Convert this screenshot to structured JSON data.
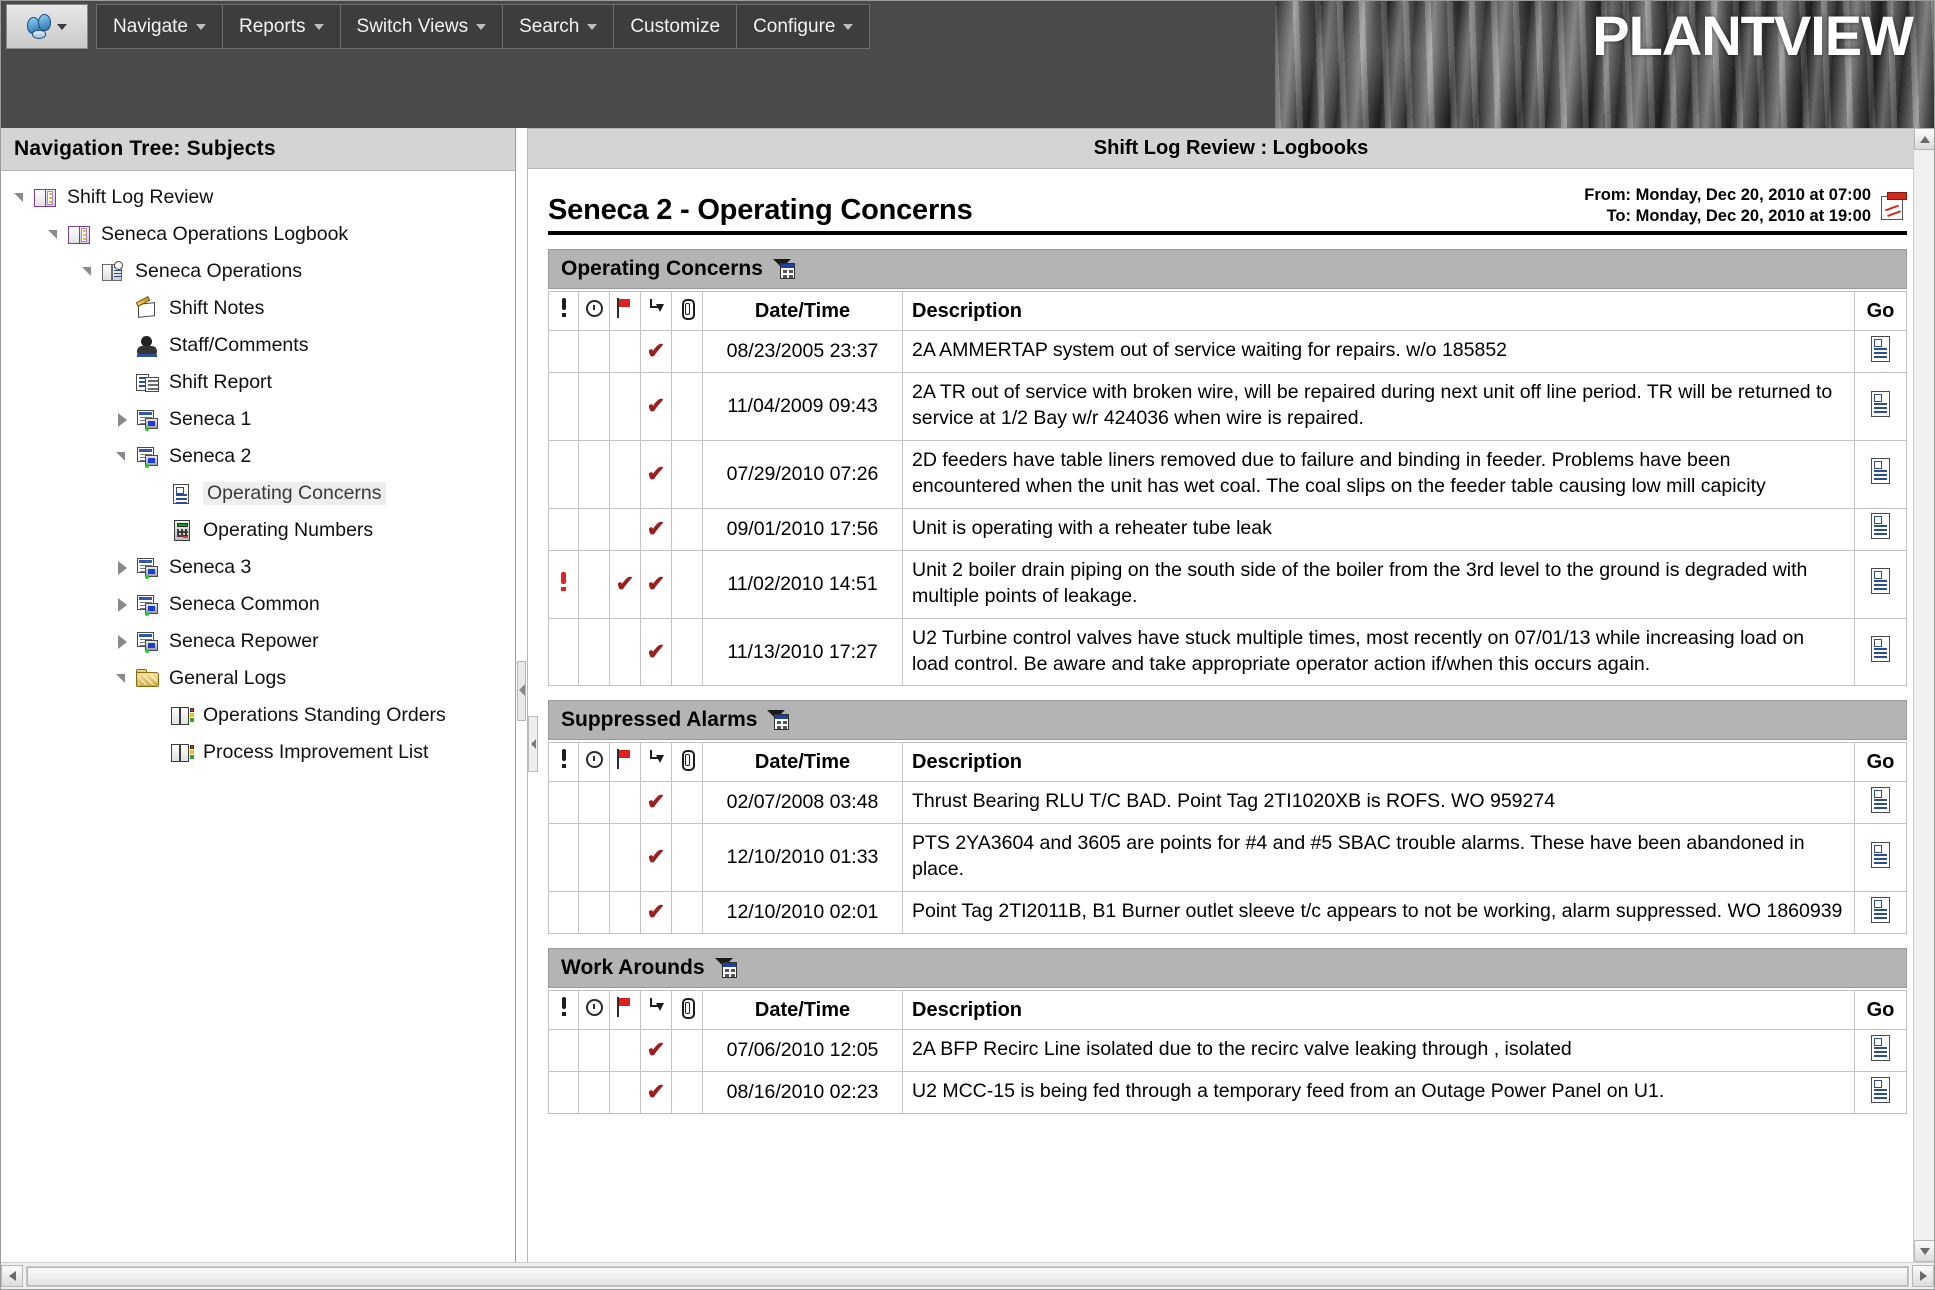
{
  "app": {
    "brand": "PLANTVIEW"
  },
  "menubar": {
    "logo_icon": "people-logo-icon",
    "items": [
      {
        "label": "Navigate",
        "has_caret": true
      },
      {
        "label": "Reports",
        "has_caret": true
      },
      {
        "label": "Switch Views",
        "has_caret": true
      },
      {
        "label": "Search",
        "has_caret": true
      },
      {
        "label": "Customize",
        "has_caret": false
      },
      {
        "label": "Configure",
        "has_caret": true
      }
    ]
  },
  "nav": {
    "header": "Navigation Tree: Subjects",
    "items": [
      {
        "label": "Shift Log Review",
        "indent": 0,
        "twisty": "open",
        "icon": "book-icon",
        "selected": false
      },
      {
        "label": "Seneca Operations Logbook",
        "indent": 1,
        "twisty": "open",
        "icon": "book-icon",
        "selected": false
      },
      {
        "label": "Seneca Operations",
        "indent": 2,
        "twisty": "open",
        "icon": "book-clock-icon",
        "selected": false
      },
      {
        "label": "Shift Notes",
        "indent": 3,
        "twisty": "none",
        "icon": "notes-icon",
        "selected": false
      },
      {
        "label": "Staff/Comments",
        "indent": 3,
        "twisty": "none",
        "icon": "staff-icon",
        "selected": false
      },
      {
        "label": "Shift Report",
        "indent": 3,
        "twisty": "none",
        "icon": "report-icon",
        "selected": false
      },
      {
        "label": "Seneca 1",
        "indent": 3,
        "twisty": "closed",
        "icon": "unit-icon",
        "selected": false
      },
      {
        "label": "Seneca 2",
        "indent": 3,
        "twisty": "open",
        "icon": "unit-icon",
        "selected": false
      },
      {
        "label": "Operating Concerns",
        "indent": 4,
        "twisty": "none",
        "icon": "document-icon",
        "selected": true
      },
      {
        "label": "Operating Numbers",
        "indent": 4,
        "twisty": "none",
        "icon": "calculator-icon",
        "selected": false
      },
      {
        "label": "Seneca 3",
        "indent": 3,
        "twisty": "closed",
        "icon": "unit-icon",
        "selected": false
      },
      {
        "label": "Seneca Common",
        "indent": 3,
        "twisty": "closed",
        "icon": "unit-icon",
        "selected": false
      },
      {
        "label": "Seneca Repower",
        "indent": 3,
        "twisty": "closed",
        "icon": "unit-icon",
        "selected": false
      },
      {
        "label": "General Logs",
        "indent": 3,
        "twisty": "open",
        "icon": "folder-icon",
        "selected": false
      },
      {
        "label": "Operations Standing Orders",
        "indent": 4,
        "twisty": "none",
        "icon": "color-book-icon",
        "selected": false
      },
      {
        "label": "Process Improvement List",
        "indent": 4,
        "twisty": "none",
        "icon": "color-book-icon",
        "selected": false
      }
    ]
  },
  "content": {
    "header": "Shift Log Review : Logbooks",
    "page_title": "Seneca 2 - Operating Concerns",
    "date_from": "From: Monday, Dec 20, 2010 at 07:00",
    "date_to": "To: Monday, Dec 20, 2010 at 19:00",
    "export_icon": "pdf-export-icon",
    "columns": {
      "priority_icon": "exclamation-icon",
      "time_icon": "clock-icon",
      "flag_icon": "red-flag-icon",
      "followup_icon": "hook-arrow-icon",
      "attachment_icon": "paperclip-icon",
      "datetime": "Date/Time",
      "description": "Description",
      "go": "Go"
    },
    "sections": [
      {
        "title": "Operating Concerns",
        "filter_icon": "filter-grid-icon",
        "rows": [
          {
            "priority": false,
            "time": false,
            "flag": false,
            "followup": true,
            "attachment": false,
            "datetime": "08/23/2005 23:37",
            "description": "2A AMMERTAP system out of service waiting for repairs. w/o 185852"
          },
          {
            "priority": false,
            "time": false,
            "flag": false,
            "followup": true,
            "attachment": false,
            "datetime": "11/04/2009 09:43",
            "description": "2A TR out of service with broken wire, will be repaired during next unit off line period. TR will be returned to service at 1/2 Bay w/r 424036 when wire is repaired."
          },
          {
            "priority": false,
            "time": false,
            "flag": false,
            "followup": true,
            "attachment": false,
            "datetime": "07/29/2010 07:26",
            "description": "2D feeders have table liners removed due to failure and binding in feeder. Problems have been encountered when the unit has wet coal. The coal slips on the feeder table causing low mill capicity"
          },
          {
            "priority": false,
            "time": false,
            "flag": false,
            "followup": true,
            "attachment": false,
            "datetime": "09/01/2010 17:56",
            "description": "Unit is operating with a reheater tube leak"
          },
          {
            "priority": true,
            "time": false,
            "flag": true,
            "followup": true,
            "attachment": false,
            "datetime": "11/02/2010 14:51",
            "description": "Unit 2 boiler drain piping on the south side of the boiler from the 3rd level to the ground is degraded with multiple points of leakage."
          },
          {
            "priority": false,
            "time": false,
            "flag": false,
            "followup": true,
            "attachment": false,
            "datetime": "11/13/2010 17:27",
            "description": "U2 Turbine control valves have stuck multiple times, most recently on 07/01/13 while increasing load on load control. Be aware and take appropriate operator action if/when this occurs again."
          }
        ]
      },
      {
        "title": "Suppressed Alarms",
        "filter_icon": "filter-grid-icon",
        "rows": [
          {
            "priority": false,
            "time": false,
            "flag": false,
            "followup": true,
            "attachment": false,
            "datetime": "02/07/2008 03:48",
            "description": "Thrust Bearing RLU T/C BAD. Point Tag 2TI1020XB is ROFS. WO 959274"
          },
          {
            "priority": false,
            "time": false,
            "flag": false,
            "followup": true,
            "attachment": false,
            "datetime": "12/10/2010 01:33",
            "description": "PTS 2YA3604 and 3605 are points for #4 and #5 SBAC trouble alarms. These have been abandoned in place."
          },
          {
            "priority": false,
            "time": false,
            "flag": false,
            "followup": true,
            "attachment": false,
            "datetime": "12/10/2010 02:01",
            "description": "Point Tag 2TI2011B, B1 Burner outlet sleeve t/c appears to not be working, alarm suppressed. WO 1860939"
          }
        ]
      },
      {
        "title": "Work Arounds",
        "filter_icon": "filter-grid-icon",
        "rows": [
          {
            "priority": false,
            "time": false,
            "flag": false,
            "followup": true,
            "attachment": false,
            "datetime": "07/06/2010 12:05",
            "description": "2A BFP Recirc Line isolated due to the recirc valve leaking through , isolated"
          },
          {
            "priority": false,
            "time": false,
            "flag": false,
            "followup": true,
            "attachment": false,
            "datetime": "08/16/2010 02:23",
            "description": "U2 MCC-15 is being fed through a temporary feed from an Outage Power Panel on U1."
          }
        ]
      }
    ],
    "go_row_icon": "document-go-icon"
  },
  "scrollbars": {
    "up_icon": "arrow-up-icon",
    "down_icon": "arrow-down-icon",
    "left_icon": "arrow-left-icon",
    "right_icon": "arrow-right-icon"
  }
}
